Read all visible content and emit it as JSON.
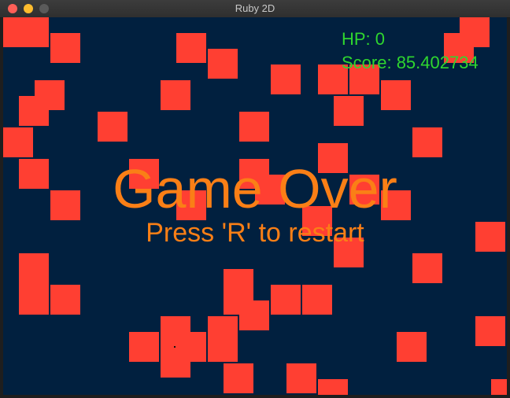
{
  "window": {
    "title": "Ruby 2D",
    "traffic_lights": {
      "close": "#fe5f57",
      "minimize": "#febc2e",
      "maximize": "#5a5a5a"
    }
  },
  "game": {
    "background_color": "#01203f",
    "block_color": "#ff3f32",
    "hud": {
      "hp": "HP: 0",
      "score": "Score: 85.402734",
      "color": "#2fd62f"
    },
    "message": {
      "title": "Game Over",
      "subtitle": "Press 'R' to restart",
      "color": "#fa7f16"
    }
  }
}
